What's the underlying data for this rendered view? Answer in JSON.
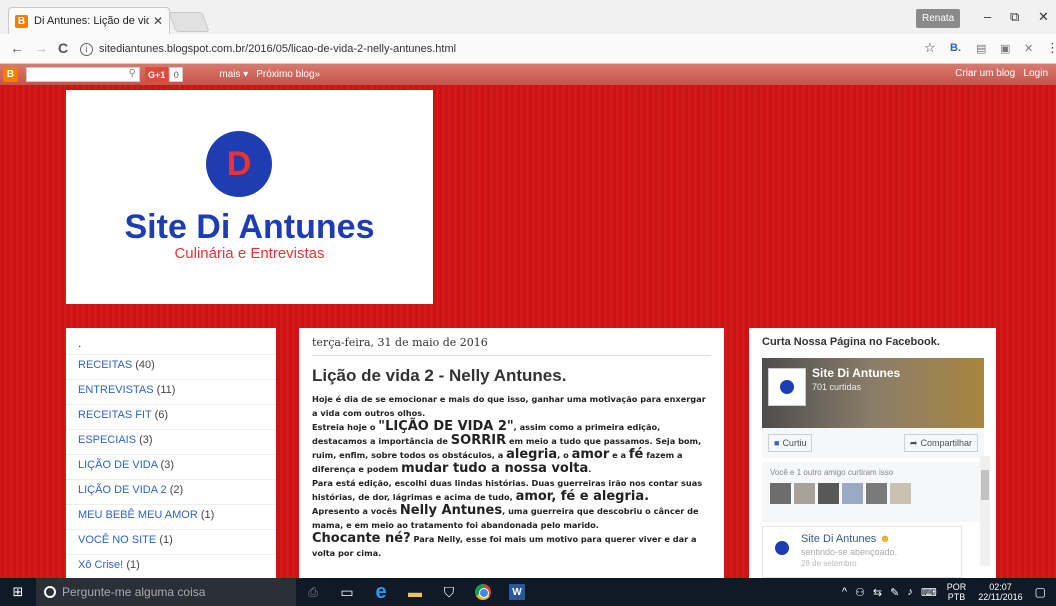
{
  "browser": {
    "tab_title": "Di Antunes: Lição de vida",
    "tab_favicon": "B",
    "profile_name": "Renata",
    "url": "sitediantunes.blogspot.com.br/2016/05/licao-de-vida-2-nelly-antunes.html",
    "win_min": "–",
    "win_max": "⧉",
    "win_close": "✕",
    "back": "←",
    "forward": "→",
    "reload": "C",
    "info": "i",
    "star": "☆",
    "menu": "⋮"
  },
  "blogger_nav": {
    "logo": "B",
    "search_icon": "⚲",
    "gplus": "G+1",
    "gplus_count": "0",
    "more": "mais ▾",
    "next_blog": "Próximo blog»",
    "create_blog": "Criar um blog",
    "login": "Login"
  },
  "header": {
    "logo_letter": "D",
    "title": "Site Di Antunes",
    "subtitle": "Culinária e Entrevistas"
  },
  "sidebar_left": {
    "title": ".",
    "items": [
      {
        "label": "RECEITAS",
        "count": "(40)"
      },
      {
        "label": "ENTREVISTAS",
        "count": "(11)"
      },
      {
        "label": "RECEITAS FIT",
        "count": "(6)"
      },
      {
        "label": "ESPECIAIS",
        "count": "(3)"
      },
      {
        "label": "LIÇÃO DE VIDA",
        "count": "(3)"
      },
      {
        "label": "LIÇÃO DE VIDA 2",
        "count": "(2)"
      },
      {
        "label": "MEU BEBÊ MEU AMOR",
        "count": "(1)"
      },
      {
        "label": "VOCÊ NO SITE",
        "count": "(1)"
      },
      {
        "label": "Xô Crise!",
        "count": "(1)"
      }
    ]
  },
  "post": {
    "date": "terça-feira, 31 de maio de 2016",
    "title": "Lição de vida 2 - Nelly Antunes.",
    "p1": "Hoje é dia de se emocionar e mais do que isso, ganhar uma motivação para enxergar a vida com outros olhos.",
    "p2a": "Estreia hoje o ",
    "p2b": "\"LIÇÃO DE VIDA 2\"",
    "p2c": ", assim como a primeira edição, destacamos a importância de ",
    "p2d": "SORRIR",
    "p2e": " em meio a tudo que passamos. Seja bom, ruim, enfim, sobre todos os obstáculos, a ",
    "p2f": "alegria",
    "p2g": ", o ",
    "p2h": "amor",
    "p2i": " e a ",
    "p2j": "fé",
    "p2k": " fazem a diferença e podem ",
    "p2l": "mudar tudo a nossa volta",
    "p2m": ".",
    "p3a": "Para está edição, escolhi duas lindas histórias. Duas guerreiras irão nos contar suas histórias, de dor, lágrimas e acima de tudo, ",
    "p3b": "amor, fé e alegria.",
    "p4a": "Apresento a vocês ",
    "p4b": "Nelly Antunes",
    "p4c": ", uma guerreira que descobriu o câncer de mama, e em meio ao tratamento foi abandonada pelo marido.",
    "p5a": "Chocante né?",
    "p5b": " Para Nelly, esse foi mais um motivo para querer viver e dar a volta por cima."
  },
  "sidebar_right": {
    "title": "Curta Nossa Página no Facebook.",
    "page_name": "Site Di Antunes",
    "likes": "701 curtidas",
    "like_button": "Curtiu",
    "share_button": "Compartilhar",
    "friends_text": "Você e 1 outro amigo curtiram isso",
    "post_author": "Site Di Antunes",
    "post_status": "sentindo-se abençoado.",
    "post_date": "28 de setembro"
  },
  "taskbar": {
    "search_placeholder": "Pergunte-me alguma coisa",
    "lang_top": "POR",
    "lang_bottom": "PTB",
    "time": "02:07",
    "date": "22/11/2016"
  }
}
